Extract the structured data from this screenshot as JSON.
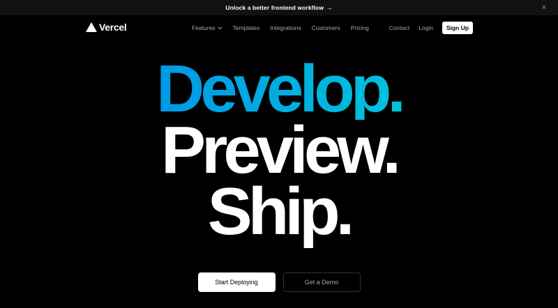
{
  "banner": {
    "text": "Unlock a better frontend workflow",
    "arrow": "→",
    "close_icon": "×"
  },
  "nav": {
    "logo": {
      "icon": "triangle-logo-icon",
      "text": "Vercel"
    },
    "links": [
      {
        "label": "Features",
        "has_dropdown": true
      },
      {
        "label": "Templates"
      },
      {
        "label": "Integrations"
      },
      {
        "label": "Customers"
      },
      {
        "label": "Pricing"
      }
    ],
    "right_links": [
      {
        "label": "Contact"
      },
      {
        "label": "Login"
      }
    ],
    "signup_label": "Sign Up"
  },
  "hero": {
    "line1": "Develop.",
    "line2": "Preview.",
    "line3": "Ship.",
    "gradient_colors": [
      "#007cf0",
      "#00dfd8"
    ]
  },
  "cta": {
    "primary_label": "Start Deploying",
    "secondary_label": "Get a Demo"
  }
}
